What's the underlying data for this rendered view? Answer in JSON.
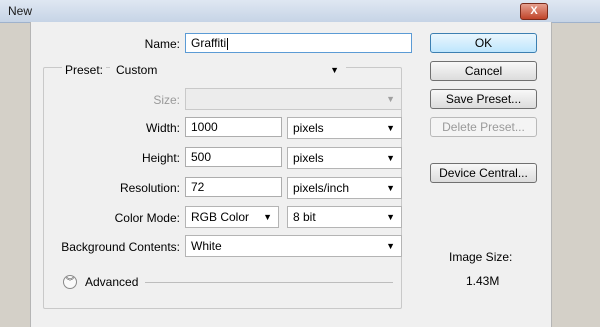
{
  "window": {
    "title": "New",
    "close_glyph": "X"
  },
  "form": {
    "name_label": "Name:",
    "name_value": "Graffiti",
    "preset_label": "Preset:",
    "preset_value": "Custom",
    "size_label": "Size:",
    "size_value": "",
    "width_label": "Width:",
    "width_value": "1000",
    "width_unit": "pixels",
    "height_label": "Height:",
    "height_value": "500",
    "height_unit": "pixels",
    "resolution_label": "Resolution:",
    "resolution_value": "72",
    "resolution_unit": "pixels/inch",
    "color_mode_label": "Color Mode:",
    "color_mode_value": "RGB Color",
    "bit_depth_value": "8 bit",
    "background_label": "Background Contents:",
    "background_value": "White",
    "advanced_label": "Advanced"
  },
  "buttons": {
    "ok": "OK",
    "cancel": "Cancel",
    "save_preset": "Save Preset...",
    "delete_preset": "Delete Preset...",
    "device_central": "Device Central..."
  },
  "image_size": {
    "label": "Image Size:",
    "value": "1.43M"
  },
  "icons": {
    "dropdown_arrow": "▼",
    "advanced_expand": "chevron-double-down-icon"
  }
}
